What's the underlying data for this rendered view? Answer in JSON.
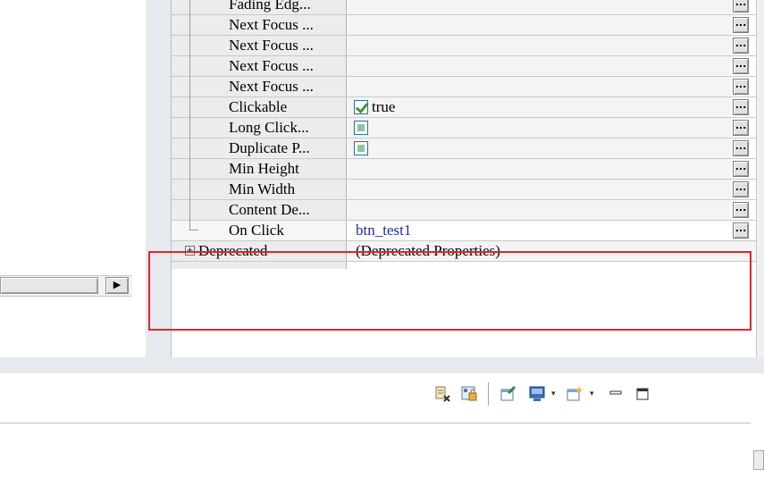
{
  "properties": {
    "rows": [
      {
        "name": "Fading Edg...",
        "value": "",
        "type": "text",
        "leaf": true
      },
      {
        "name": "Next Focus ...",
        "value": "",
        "type": "text",
        "leaf": true
      },
      {
        "name": "Next Focus ...",
        "value": "",
        "type": "text",
        "leaf": true
      },
      {
        "name": "Next Focus ...",
        "value": "",
        "type": "text",
        "leaf": true
      },
      {
        "name": "Next Focus ...",
        "value": "",
        "type": "text",
        "leaf": true
      },
      {
        "name": "Clickable",
        "value": "true",
        "type": "checkbox",
        "state": "checked"
      },
      {
        "name": "Long Click...",
        "value": "",
        "type": "checkbox",
        "state": "indeterminate"
      },
      {
        "name": "Duplicate P...",
        "value": "",
        "type": "checkbox",
        "state": "indeterminate"
      },
      {
        "name": "Min Height",
        "value": "",
        "type": "text"
      },
      {
        "name": "Min Width",
        "value": "",
        "type": "text"
      },
      {
        "name": "Content De...",
        "value": "",
        "type": "text"
      },
      {
        "name": "On Click",
        "value": "btn_test1",
        "type": "text",
        "selected": true,
        "valueColor": "#1f2f9a"
      }
    ],
    "group": {
      "name": "Deprecated",
      "value": "(Deprecated Properties)",
      "expand_symbol": "+"
    },
    "ellipsis_label": "..."
  },
  "left_pane": {
    "scroll_arrow": "▶"
  },
  "toolbar": {
    "icons": [
      "remove-attribute-icon",
      "lock-icon",
      "pin-icon",
      "monitor-icon",
      "new-view-icon",
      "minimize-icon",
      "maximize-icon"
    ],
    "dropdown_symbol": "▾"
  },
  "colors": {
    "highlight": "#e0262b",
    "selected_value": "#1f2f9a"
  }
}
